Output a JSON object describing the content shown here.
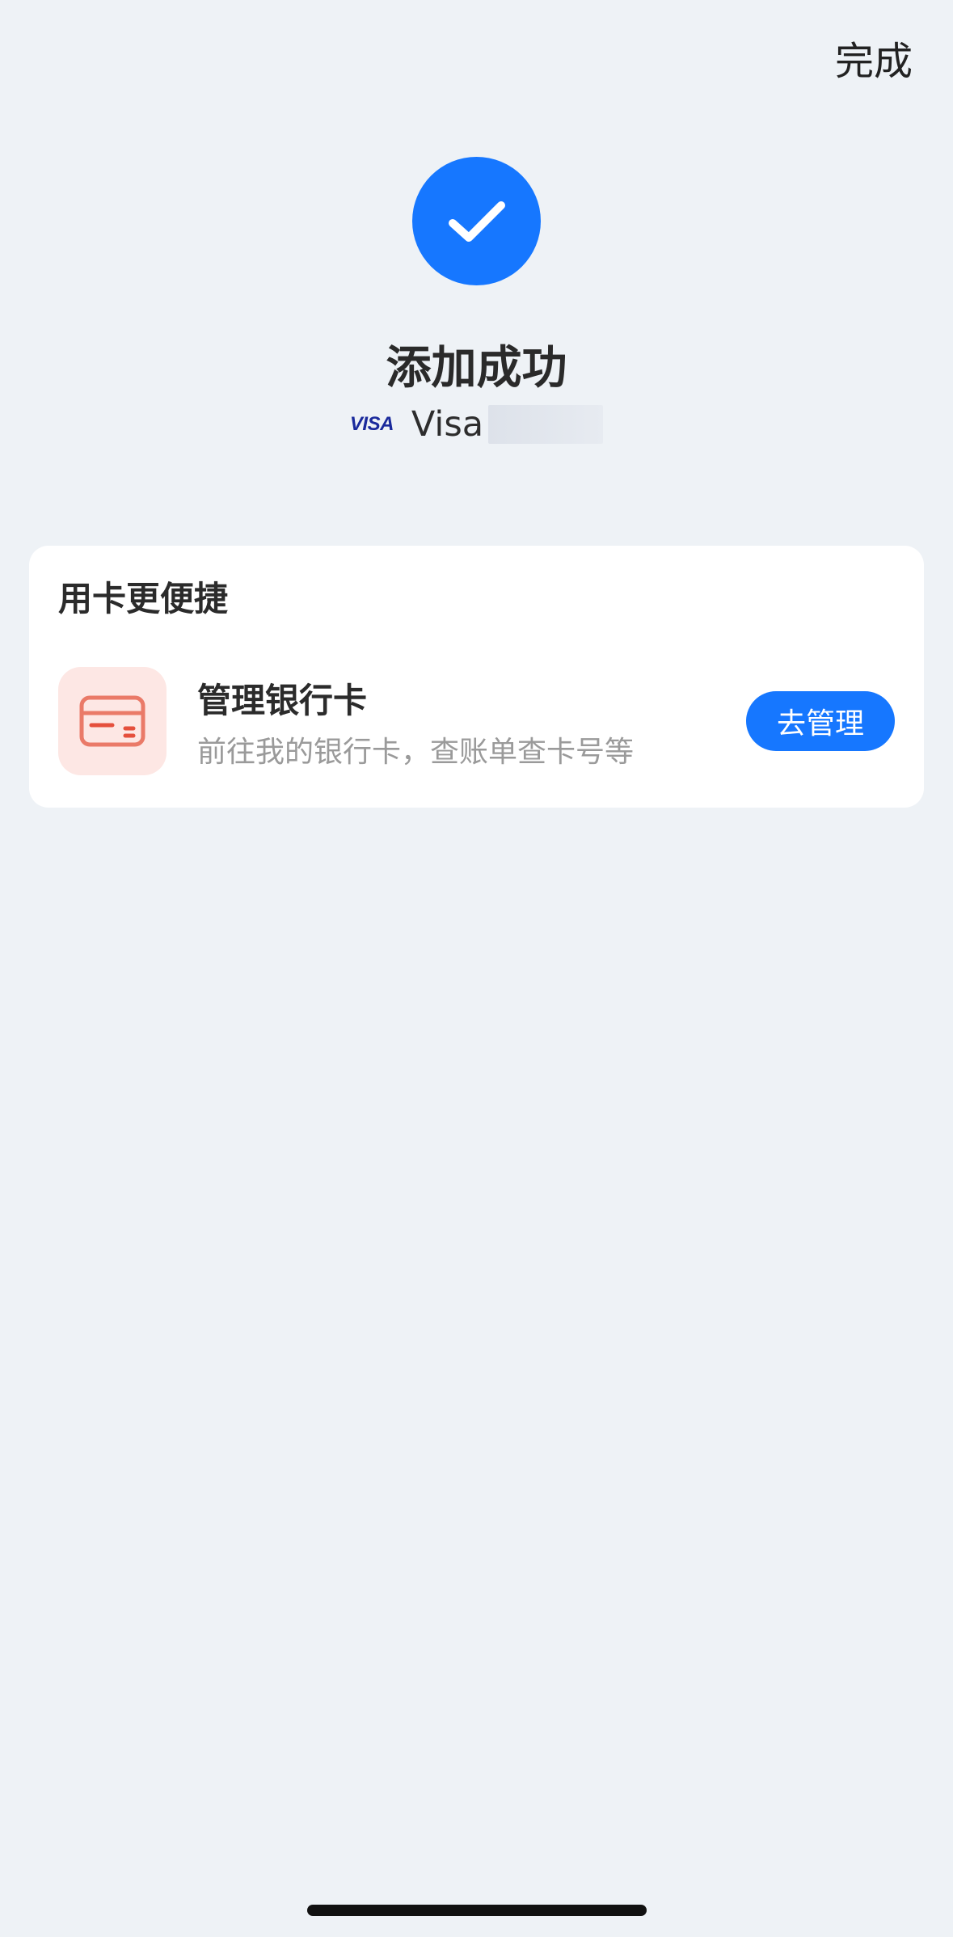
{
  "header": {
    "done_label": "完成"
  },
  "result": {
    "title": "添加成功",
    "card_logo": "VISA",
    "card_brand": "Visa",
    "icon": "checkmark-icon",
    "accent_color": "#1677ff"
  },
  "panel": {
    "title": "用卡更便捷",
    "feature": {
      "icon": "credit-card-icon",
      "name": "管理银行卡",
      "description": "前往我的银行卡，查账单查卡号等",
      "button_label": "去管理"
    }
  }
}
